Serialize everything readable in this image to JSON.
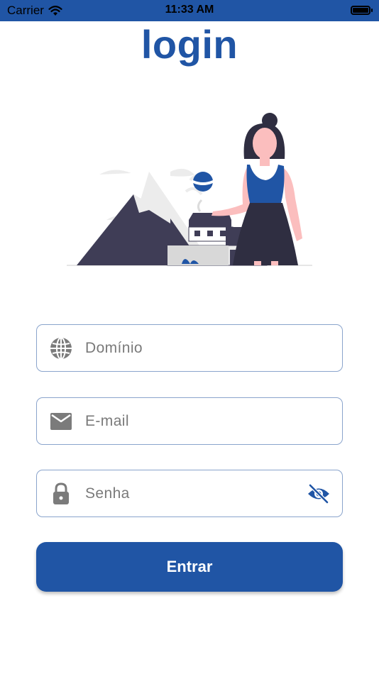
{
  "status_bar": {
    "carrier": "Carrier",
    "time": "11:33 AM",
    "wifi_icon": "wifi-icon",
    "battery_icon": "battery-icon"
  },
  "title": "login",
  "illustration": {
    "name": "woman-house-mountain-illustration"
  },
  "form": {
    "domain": {
      "placeholder": "Domínio",
      "icon": "globe-icon"
    },
    "email": {
      "placeholder": "E-mail",
      "icon": "mail-icon"
    },
    "password": {
      "placeholder": "Senha",
      "icon": "lock-icon",
      "toggle_icon": "eye-off-icon"
    },
    "submit_label": "Entrar"
  },
  "colors": {
    "primary": "#2055a5",
    "border": "#8aa4cc",
    "placeholder": "#7a7a7a",
    "icon_gray": "#7b7b7b"
  }
}
